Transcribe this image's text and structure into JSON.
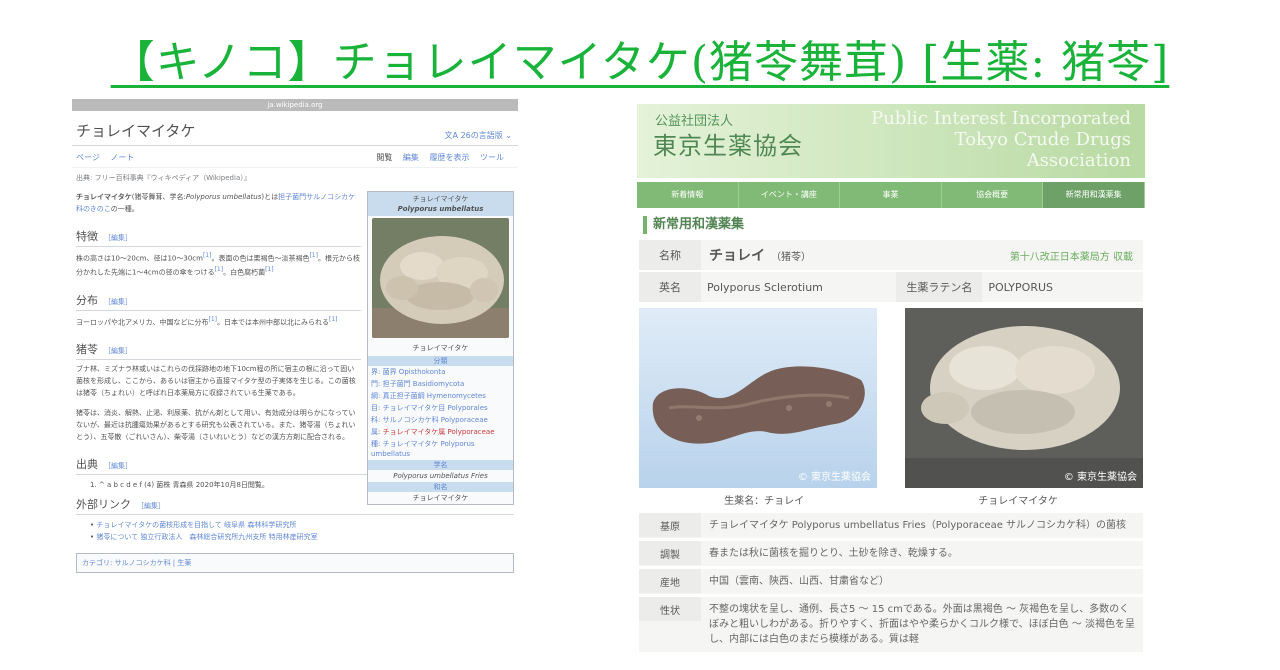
{
  "title": "【キノコ】チョレイマイタケ(猪苓舞茸) [生薬: 猪苓]",
  "wiki": {
    "domain": "ja.wikipedia.org",
    "page_title": "チョレイマイタケ",
    "lang_count": "26の言語版",
    "tab_page": "ページ",
    "tab_note": "ノート",
    "tab_read": "閲覧",
    "tab_edit": "編集",
    "tab_history": "履歴を表示",
    "tab_tools": "ツール",
    "source": "出典: フリー百科事典『ウィキペディア（Wikipedia）』",
    "edit_label": "［編集］",
    "intro_bold": "チョレイマイタケ",
    "intro_text": "(猪苓舞茸、学名:",
    "intro_sci": "Polyporus umbellatus",
    "intro_text2": ")とは",
    "intro_link": "担子菌門サルノコシカケ科のきのこ",
    "intro_end": "の一種。",
    "h_features": "特徴",
    "features_text": "株の高さは10〜20cm、径は10〜30cm",
    "features_text2": "。表面の色は栗褐色〜淡茶褐色",
    "features_text3": "。根元から枝分かれした先端に1〜4cmの径の傘をつける",
    "features_text4": "。白色腐朽菌",
    "ref1": "[1]",
    "h_distribution": "分布",
    "distribution_text": "ヨーロッパや北アメリカ、中国などに分布",
    "distribution_text2": "。日本では本州中部以北にみられる",
    "h_chorei": "猪苓",
    "chorei_text": "ブナ林、ミズナラ林或いはこれらの伐採跡地の地下10cm程の所に宿主の根に沿って固い菌核を形成し、ここから、あるいは宿主から直接マイタケ型の子実体を生じる。この菌核は猪苓（ちょれい）と呼ばれ日本薬局方に収録されている生薬である。",
    "chorei_text2": "猪苓は、消炎、解熱、止渇、利尿薬、抗がん剤として用い、有効成分は明らかになっていないが、最近は抗腫瘍効果があるとする研究も公表されている。また、猪苓湯（ちょれいとう）、五苓散（ごれいさん）、柴苓湯（さいれいとう）などの漢方方剤に配合される。",
    "h_refs": "出典",
    "ref_item": "1. ^ a b c d e f (4) 菌株 青森県 2020年10月8日閲覧。",
    "h_links": "外部リンク",
    "link1": "チョレイマイタケの菌核形成を目指して 岐阜県 森林科学研究所",
    "link2": "猪苓について 独立行政法人　森林総合研究所九州支所 特用林産研究室",
    "categories": "カテゴリ: サルノコシカケ科 | 生薬",
    "infobox": {
      "name": "チョレイマイタケ",
      "sci": "Polyporus umbellatus",
      "caption": "チョレイマイタケ",
      "classification": "分類",
      "rows": [
        {
          "k": "界",
          "v": ": 菌界 Opisthokonta"
        },
        {
          "k": "門",
          "v": ": 担子菌門 Basidiomycota"
        },
        {
          "k": "綱",
          "v": ": 真正担子菌綱 Hymenomycetes"
        },
        {
          "k": "目",
          "v": ": チョレイマイタケ目 Polyporales"
        },
        {
          "k": "科",
          "v": ": サルノコシカケ科 Polyporaceae"
        },
        {
          "k": "属",
          "v": ": チョレイマイタケ属 Polyporaceae",
          "red": true
        },
        {
          "k": "種",
          "v": ": チョレイマイタケ Polyporus umbellatus"
        }
      ],
      "h_sci": "学名",
      "sci_full": "Polyporus umbellatus Fries",
      "h_jp": "和名",
      "jp_name": "チョレイマイタケ"
    }
  },
  "tcd": {
    "org_type": "公益社団法人",
    "org_name": "東京生薬協会",
    "eng_line1": "Public Interest Incorporated",
    "eng_line2": "Tokyo Crude Drugs",
    "eng_line3": "Association",
    "nav": [
      "新着情報",
      "イベント・講座",
      "事業",
      "協会概要",
      "新常用和漢薬集"
    ],
    "section": "新常用和漢薬集",
    "label_name": "名称",
    "name": "チョレイ",
    "name_kanji": "（猪苓）",
    "jp_pharma": "第十八改正日本薬局方 収載",
    "label_en": "英名",
    "en_name": "Polyporus Sclerotium",
    "label_latin": "生薬ラテン名",
    "latin_name": "POLYPORUS",
    "copyright": "© 東京生薬協会",
    "photo1_caption": "生薬名：チョレイ",
    "photo2_caption": "チョレイマイタケ",
    "label_origin": "基原",
    "origin": "チョレイマイタケ Polyporus umbellatus Fries（Polyporaceae サルノコシカケ科）の菌核",
    "label_prep": "調製",
    "prep": "春または秋に菌核を掘りとり、土砂を除き、乾燥する。",
    "label_prod": "産地",
    "prod": "中国（雲南、陝西、山西、甘粛省など）",
    "label_prop": "性状",
    "prop": "不整の塊状を呈し、通例、長さ5 〜 15 cmである。外面は黒褐色 〜 灰褐色を呈し、多数のくぼみと粗いしわがある。折りやすく、折面はやや柔らかくコルク様で、ほぼ白色 〜 淡褐色を呈し、内部には白色のまだら模様がある。質は軽"
  }
}
